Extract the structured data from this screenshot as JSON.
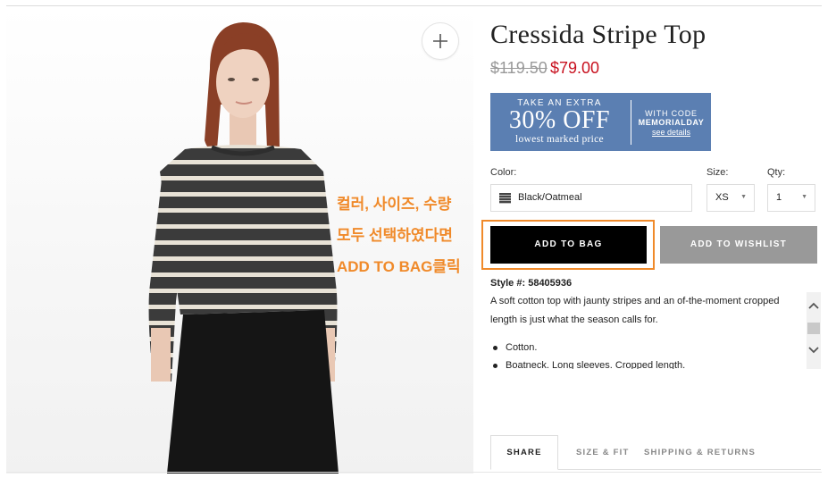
{
  "product": {
    "title": "Cressida Stripe Top",
    "price_original": "$119.50",
    "price_sale": "$79.00"
  },
  "promo": {
    "line1": "TAKE AN EXTRA",
    "line2": "30% OFF",
    "line3": "lowest marked price",
    "code_label": "WITH CODE",
    "code": "MEMORIALDAY",
    "link": "see details",
    "color": "#5b7fb2"
  },
  "options": {
    "color_label": "Color:",
    "color_value": "Black/Oatmeal",
    "size_label": "Size:",
    "size_value": "XS",
    "qty_label": "Qty:",
    "qty_value": "1"
  },
  "buttons": {
    "add_to_bag": "ADD TO BAG",
    "add_to_wishlist": "ADD TO WISHLIST"
  },
  "annotation": {
    "line1": "컬러, 사이즈, 수량",
    "line2": "모두 선택하였다면",
    "line3": "ADD TO BAG클릭",
    "color": "#f08a2a"
  },
  "details": {
    "style_label": "Style #:",
    "style_number": "58405936",
    "description": "A soft cotton top with jaunty stripes and an of-the-moment cropped length is just what the season calls for.",
    "bullets": [
      "Cotton.",
      "Boatneck. Long sleeves. Cropped length."
    ]
  },
  "tabs": [
    "SHARE",
    "SIZE & FIT",
    "SHIPPING & RETURNS"
  ],
  "colors": {
    "sale_price": "#c8101e",
    "button_primary": "#000000",
    "button_secondary": "#999999"
  }
}
